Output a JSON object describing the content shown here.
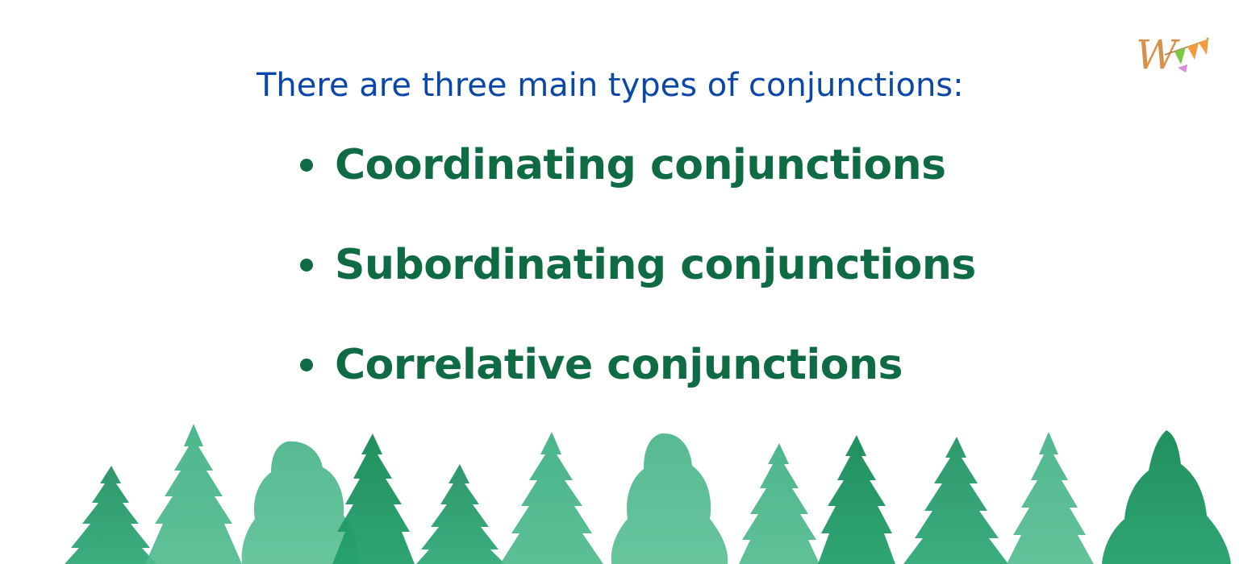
{
  "heading": "There are three main types of conjunctions:",
  "items": [
    {
      "label": "Coordinating conjunctions"
    },
    {
      "label": "Subordinating conjunctions"
    },
    {
      "label": "Correlative conjunctions"
    }
  ],
  "logo": {
    "letter": "W",
    "icon": "bunting-flags-icon"
  },
  "colors": {
    "heading": "#0b47a8",
    "items": "#0e6b43",
    "trees": "#1f9a68",
    "logo_letter": "#d9904a",
    "flag_orange": "#f39a3c",
    "flag_green": "#7ac943",
    "flag_pink": "#d98ad9"
  }
}
